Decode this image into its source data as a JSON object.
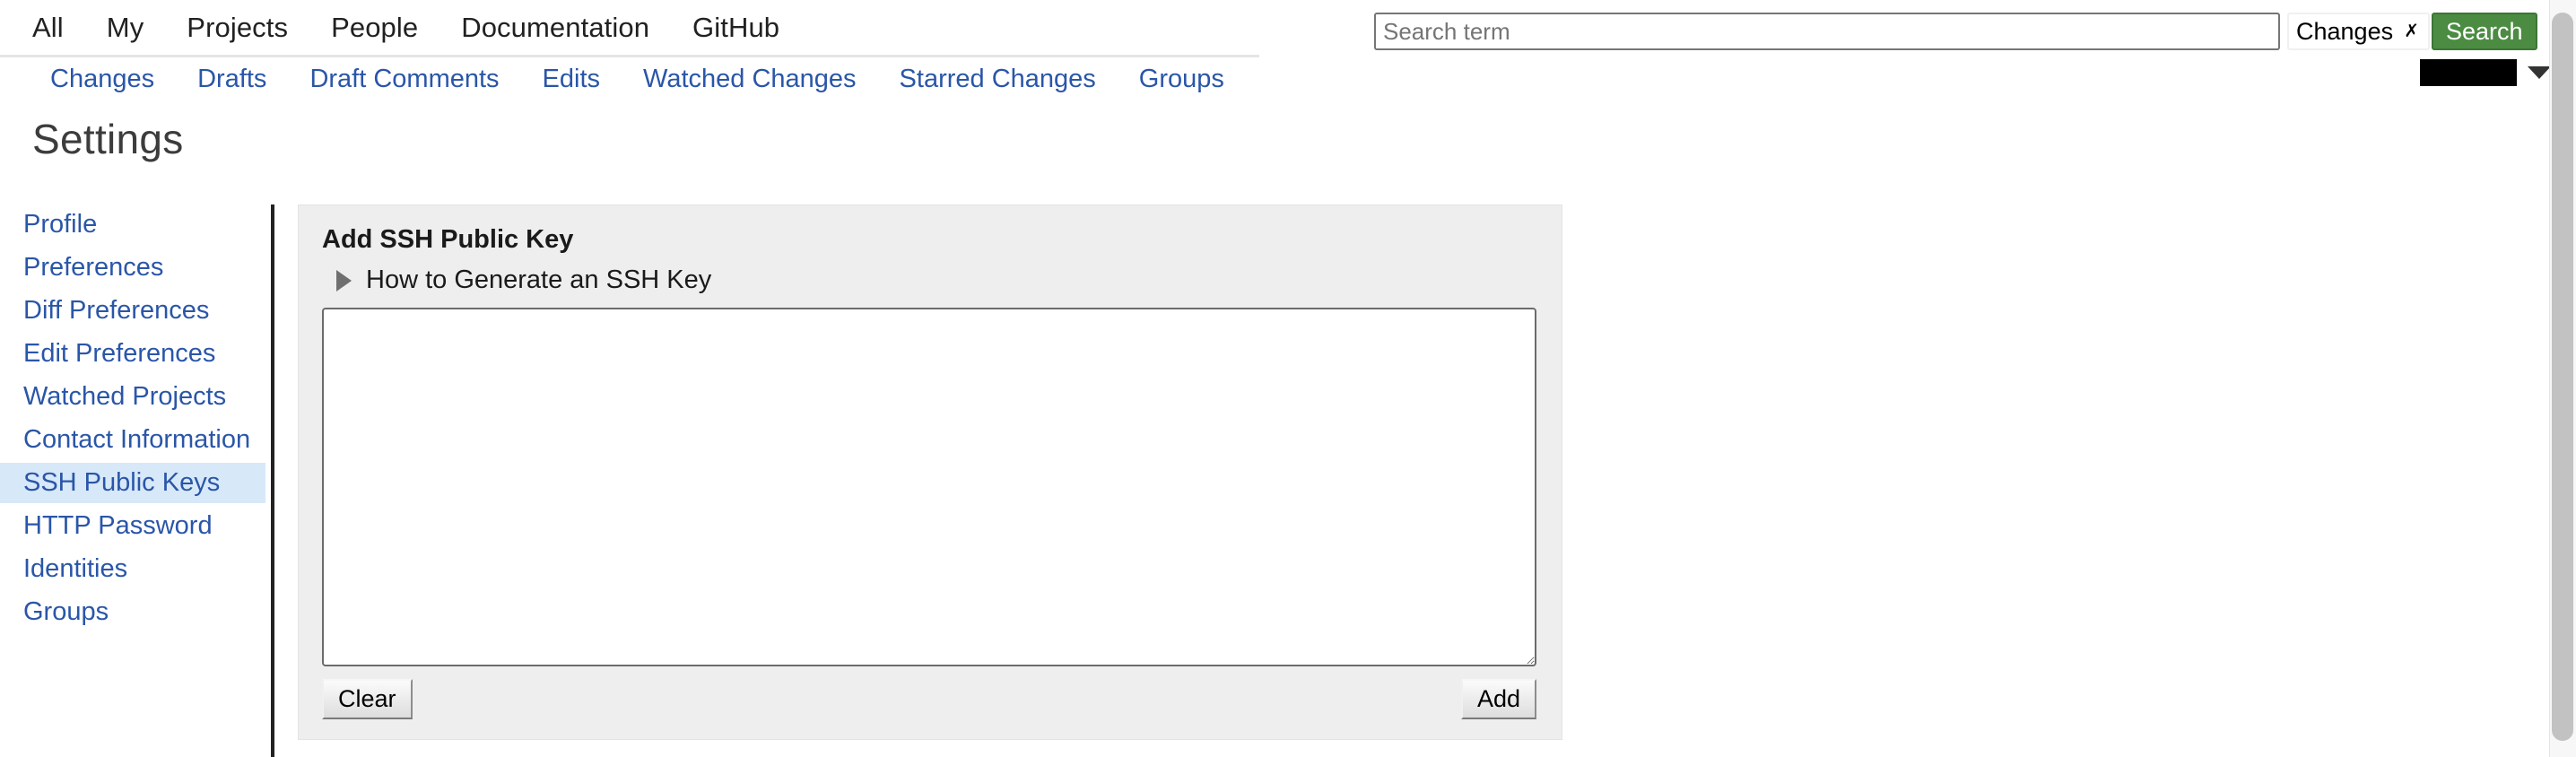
{
  "header": {
    "primary_nav": [
      {
        "label": "All"
      },
      {
        "label": "My"
      },
      {
        "label": "Projects"
      },
      {
        "label": "People"
      },
      {
        "label": "Documentation"
      },
      {
        "label": "GitHub"
      }
    ],
    "secondary_nav": [
      {
        "label": "Changes"
      },
      {
        "label": "Drafts"
      },
      {
        "label": "Draft Comments"
      },
      {
        "label": "Edits"
      },
      {
        "label": "Watched Changes"
      },
      {
        "label": "Starred Changes"
      },
      {
        "label": "Groups"
      }
    ],
    "search": {
      "placeholder": "Search term",
      "value": "",
      "scope_selected": "Changes",
      "scope_options": [
        "Changes"
      ],
      "button_label": "Search",
      "button_color": "#4b8c42",
      "caret_icon": "chevron-down-icon"
    },
    "account": {
      "name_redacted": "",
      "caret_icon": "triangle-down-icon"
    }
  },
  "page": {
    "title": "Settings"
  },
  "settings_menu": {
    "items": [
      {
        "label": "Profile",
        "active": false
      },
      {
        "label": "Preferences",
        "active": false
      },
      {
        "label": "Diff Preferences",
        "active": false
      },
      {
        "label": "Edit Preferences",
        "active": false
      },
      {
        "label": "Watched Projects",
        "active": false
      },
      {
        "label": "Contact Information",
        "active": false
      },
      {
        "label": "SSH Public Keys",
        "active": true
      },
      {
        "label": "HTTP Password",
        "active": false
      },
      {
        "label": "Identities",
        "active": false
      },
      {
        "label": "Groups",
        "active": false
      }
    ],
    "active_highlight_color": "#d7e8f8",
    "link_color": "#2a56a8"
  },
  "ssh_panel": {
    "heading": "Add SSH Public Key",
    "disclosure": {
      "label": "How to Generate an SSH Key",
      "expanded": false,
      "icon": "triangle-right-icon"
    },
    "textarea": {
      "value": "",
      "placeholder": ""
    },
    "clear_button": "Clear",
    "add_button": "Add"
  }
}
